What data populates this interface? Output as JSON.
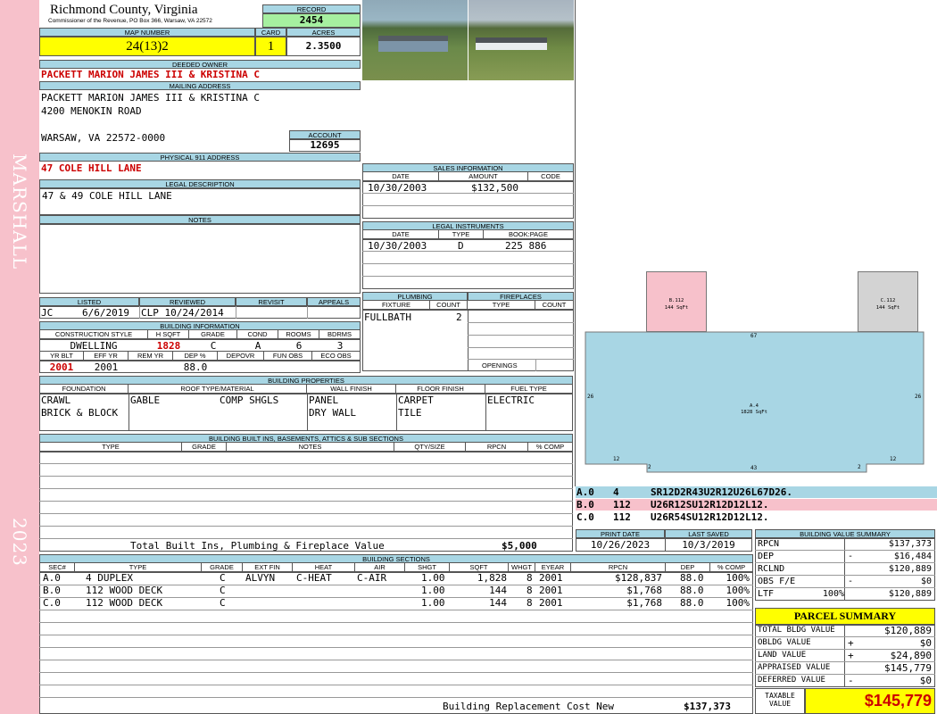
{
  "side": {
    "district": "MARSHALL",
    "year": "2023"
  },
  "header": {
    "county": "Richmond County, Virginia",
    "commissioner": "Commissioner of the Revenue, PO Box 366, Warsaw, VA 22572",
    "record_label": "RECORD",
    "record": "2454",
    "map_label": "MAP NUMBER",
    "map": "24(13)2",
    "card_label": "CARD",
    "card": "1",
    "acres_label": "ACRES",
    "acres": "2.3500"
  },
  "owner": {
    "deeded_label": "DEEDED OWNER",
    "deeded": "PACKETT MARION JAMES III & KRISTINA C",
    "mailing_label": "MAILING ADDRESS",
    "mailing_1": "PACKETT MARION JAMES III & KRISTINA C",
    "mailing_2": "4200 MENOKIN ROAD",
    "mailing_3": "WARSAW, VA 22572-0000",
    "account_label": "ACCOUNT",
    "account": "12695",
    "physical_label": "PHYSICAL 911 ADDRESS",
    "physical": "47 COLE HILL LANE",
    "legal_label": "LEGAL DESCRIPTION",
    "legal": "47 & 49 COLE HILL LANE",
    "notes_label": "NOTES"
  },
  "sales": {
    "title": "SALES INFORMATION",
    "cols": [
      "DATE",
      "AMOUNT",
      "CODE"
    ],
    "row": {
      "date": "10/30/2003",
      "amount": "$132,500",
      "code": ""
    }
  },
  "legal_instruments": {
    "title": "LEGAL INSTRUMENTS",
    "cols": [
      "DATE",
      "TYPE",
      "BOOK:PAGE"
    ],
    "row": {
      "date": "10/30/2003",
      "type": "D",
      "bookpage": "225 886"
    }
  },
  "listing": {
    "cols": [
      "LISTED",
      "REVIEWED",
      "REVISIT",
      "APPEALS"
    ],
    "listed_by": "JC",
    "listed_date": "6/6/2019",
    "reviewed": "CLP 10/24/2014"
  },
  "building_info": {
    "title": "BUILDING INFORMATION",
    "cols1": [
      "CONSTRUCTION STYLE",
      "H SQFT",
      "GRADE",
      "COND",
      "ROOMS",
      "BDRMS"
    ],
    "style": "DWELLING",
    "hsqft": "1828",
    "grade": "C",
    "cond": "A",
    "rooms": "6",
    "bdrms": "3",
    "cols2": [
      "YR BLT",
      "EFF YR",
      "REM YR",
      "DEP %",
      "DEPOVR",
      "FUN OBS",
      "ECO OBS"
    ],
    "yrblt": "2001",
    "effyr": "2001",
    "dep": "88.0"
  },
  "plumbing": {
    "title": "PLUMBING",
    "cols": [
      "FIXTURE",
      "COUNT"
    ],
    "fixture": "FULLBATH",
    "count": "2"
  },
  "fireplaces": {
    "title": "FIREPLACES",
    "cols": [
      "TYPE",
      "COUNT"
    ],
    "openings": "OPENINGS"
  },
  "properties": {
    "title": "BUILDING PROPERTIES",
    "cols": [
      "FOUNDATION",
      "ROOF TYPE/MATERIAL",
      "WALL FINISH",
      "FLOOR FINISH",
      "FUEL TYPE"
    ],
    "foundation_1": "CRAWL",
    "foundation_2": "BRICK & BLOCK",
    "roof_type": "GABLE",
    "roof_material": "COMP SHGLS",
    "wall_1": "PANEL",
    "wall_2": "DRY WALL",
    "floor_1": "CARPET",
    "floor_2": "TILE",
    "fuel": "ELECTRIC"
  },
  "builtins": {
    "title": "BUILDING BUILT INS, BASEMENTS, ATTICS & SUB SECTIONS",
    "cols": [
      "TYPE",
      "GRADE",
      "NOTES",
      "QTY/SIZE",
      "RPCN",
      "% COMP"
    ],
    "total_label": "Total Built Ins, Plumbing & Fireplace Value",
    "total": "$5,000"
  },
  "sketch": {
    "a_label": "A.4",
    "a_area": "1828 SqFt",
    "b_label": "B.112",
    "b_area": "144 SqFt",
    "c_label": "C.112",
    "c_area": "144 SqFt",
    "dim_top": "67",
    "dim_left": "26",
    "dim_right": "26",
    "dim_bottom": "43",
    "dim_bl": "12",
    "dim_br": "12",
    "dim_b2l": "2",
    "dim_b2r": "2"
  },
  "vectors": [
    {
      "sec": "A.0",
      "code": "4",
      "vec": "SR12D2R43U2R12U26L67D26."
    },
    {
      "sec": "B.0",
      "code": "112",
      "vec": "U26R12SU12R12D12L12."
    },
    {
      "sec": "C.0",
      "code": "112",
      "vec": "U26R54SU12R12D12L12."
    }
  ],
  "dates": {
    "print_label": "PRINT DATE",
    "print": "10/26/2023",
    "saved_label": "LAST SAVED",
    "saved": "10/3/2019"
  },
  "sections": {
    "title": "BUILDING SECTIONS",
    "cols": [
      "SEC#",
      "TYPE",
      "GRADE",
      "EXT FIN",
      "HEAT",
      "AIR",
      "SHGT",
      "SQFT",
      "WHGT",
      "EYEAR",
      "RPCN",
      "DEP",
      "% COMP"
    ],
    "rows": [
      {
        "sec": "A.0",
        "type": "4 DUPLEX",
        "grade": "C",
        "ext": "ALVYN",
        "heat": "C-HEAT",
        "air": "C-AIR",
        "shgt": "1.00",
        "sqft": "1,828",
        "whgt": "8",
        "eyear": "2001",
        "rpcn": "$128,837",
        "dep": "88.0",
        "comp": "100%"
      },
      {
        "sec": "B.0",
        "type": "112 WOOD DECK",
        "grade": "C",
        "ext": "",
        "heat": "",
        "air": "",
        "shgt": "1.00",
        "sqft": "144",
        "whgt": "8",
        "eyear": "2001",
        "rpcn": "$1,768",
        "dep": "88.0",
        "comp": "100%"
      },
      {
        "sec": "C.0",
        "type": "112 WOOD DECK",
        "grade": "C",
        "ext": "",
        "heat": "",
        "air": "",
        "shgt": "1.00",
        "sqft": "144",
        "whgt": "8",
        "eyear": "2001",
        "rpcn": "$1,768",
        "dep": "88.0",
        "comp": "100%"
      }
    ],
    "replacement_label": "Building Replacement Cost New",
    "replacement": "$137,373"
  },
  "bvs": {
    "title": "BUILDING VALUE SUMMARY",
    "rpcn_label": "RPCN",
    "rpcn": "$137,373",
    "dep_label": "DEP",
    "dep_sign": "-",
    "dep": "$16,484",
    "rclnd_label": "RCLND",
    "rclnd": "$120,889",
    "obs_label": "OBS F/E",
    "obs_sign": "-",
    "obs": "$0",
    "ltf_label": "LTF",
    "ltf_pct": "100%",
    "ltf": "$120,889"
  },
  "parcel": {
    "title": "PARCEL SUMMARY",
    "total_bldg_label": "TOTAL BLDG VALUE",
    "total_bldg": "$120,889",
    "obldg_label": "OBLDG VALUE",
    "obldg_sign": "+",
    "obldg": "$0",
    "land_label": "LAND VALUE",
    "land_sign": "+",
    "land": "$24,890",
    "appraised_label": "APPRAISED VALUE",
    "appraised": "$145,779",
    "deferred_label": "DEFERRED VALUE",
    "deferred_sign": "-",
    "deferred": "$0",
    "taxable_label_1": "TAXABLE",
    "taxable_label_2": "VALUE",
    "taxable": "$145,779"
  },
  "colors": {
    "header": "#a8d6e4",
    "yellow": "#ffff00",
    "green": "#a6f0a0",
    "pink": "#f7c1cb",
    "red": "#cc0000",
    "sketch": "#a8d6e4"
  }
}
